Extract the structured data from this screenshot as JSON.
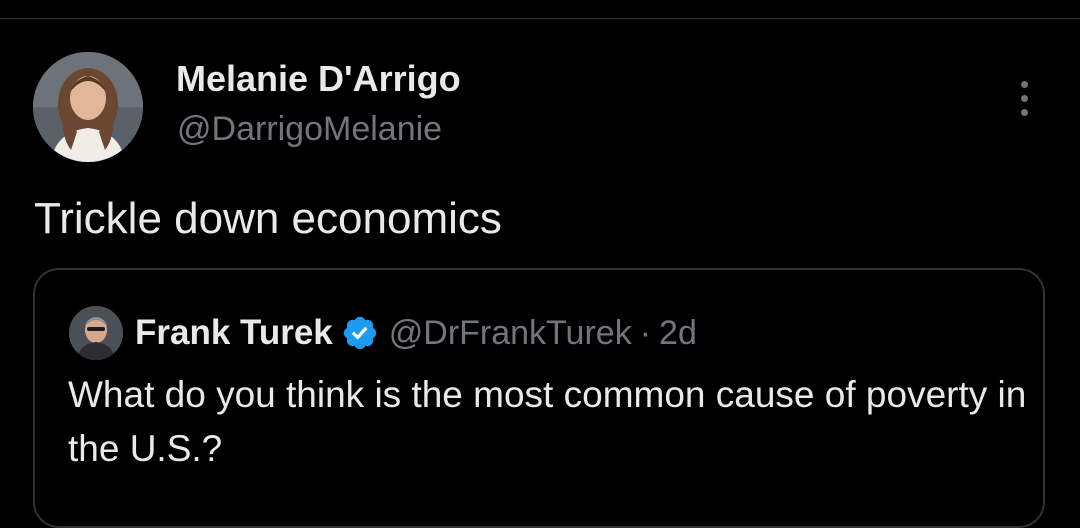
{
  "tweet": {
    "author": {
      "name": "Melanie D'Arrigo",
      "handle": "@DarrigoMelanie",
      "avatar_icon": "profile-photo"
    },
    "more_icon": "more-vertical-icon",
    "text": "Trickle down economics",
    "quote": {
      "author": {
        "name": "Frank Turek",
        "handle": "@DrFrankTurek",
        "verified_icon": "verified-badge-icon",
        "avatar_icon": "profile-photo"
      },
      "separator": "·",
      "time": "2d",
      "text": "What do you think is the most common cause of poverty in the U.S.?"
    }
  },
  "colors": {
    "background": "#000000",
    "primary_text": "#e7e9ea",
    "secondary_text": "#71767b",
    "border": "#2f3336",
    "verified_blue": "#1d9bf0"
  }
}
